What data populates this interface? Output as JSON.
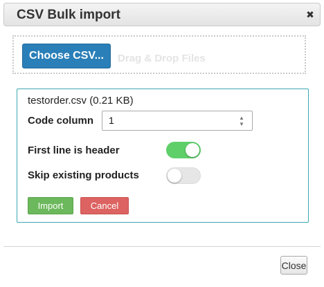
{
  "dialog": {
    "title": "CSV Bulk import",
    "close_icon": "close-icon",
    "close_glyph": "✖"
  },
  "upload": {
    "choose_label": "Choose CSV...",
    "drag_label": "Drag & Drop Files"
  },
  "file": {
    "name": "testorder.csv (0.21 KB)",
    "code_column_label": "Code column",
    "code_column_value": "1",
    "first_line_header_label": "First line is header",
    "first_line_header_enabled": true,
    "skip_existing_label": "Skip existing products",
    "skip_existing_enabled": false,
    "import_label": "Import",
    "cancel_label": "Cancel"
  },
  "footer": {
    "close_label": "Close"
  },
  "colors": {
    "choose_button": "#2a7fb8",
    "toggle_on": "#5fcf6a",
    "import_button": "#6cb85c",
    "cancel_button": "#dc6361",
    "panel_border": "#3aa8b3"
  }
}
